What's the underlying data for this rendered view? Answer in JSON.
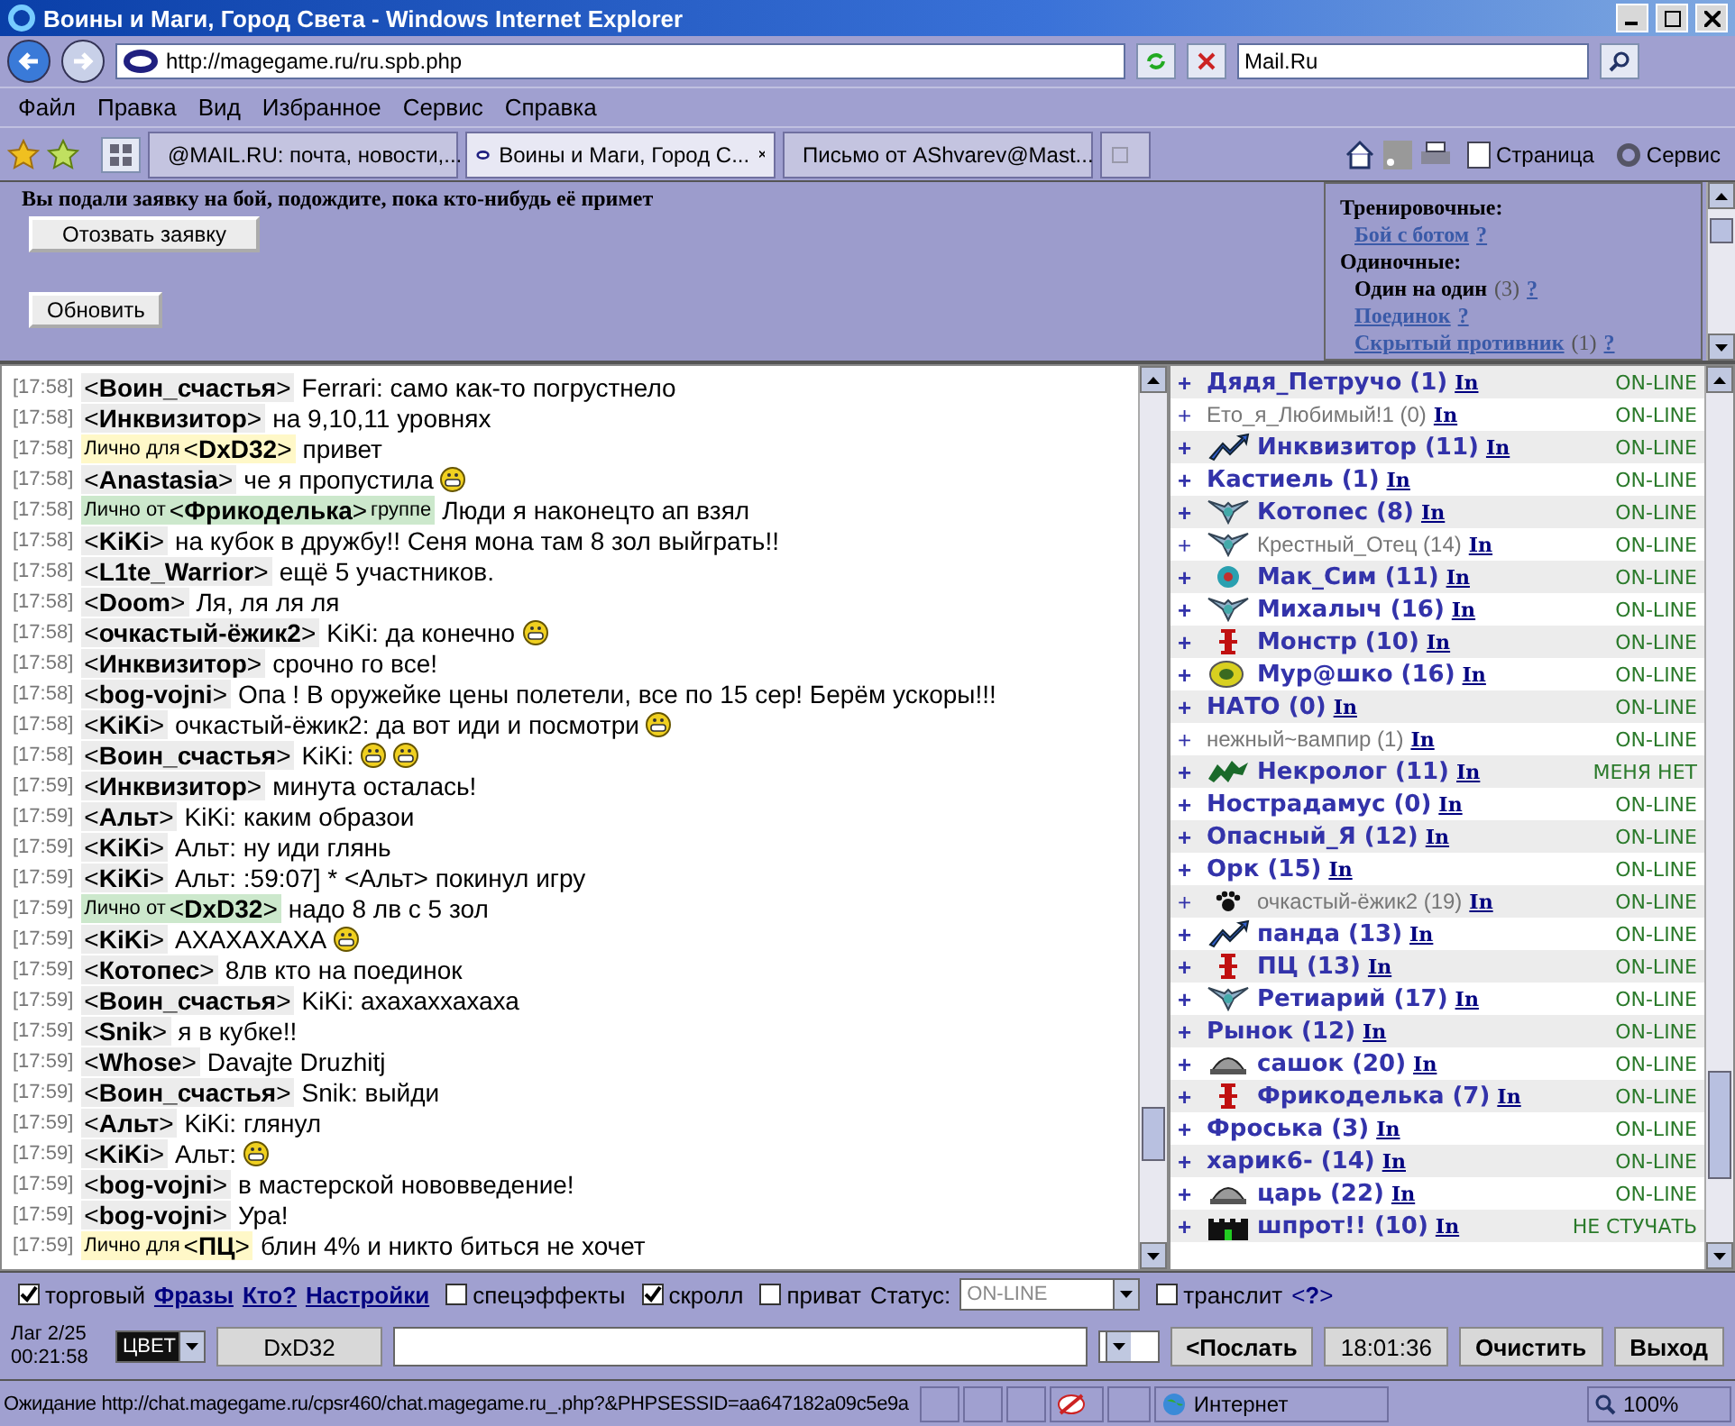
{
  "window": {
    "title": "Воины и Маги, Город Света - Windows Internet Explorer"
  },
  "address_bar": {
    "url": "http://magegame.ru/ru.spb.php",
    "search": "Mail.Ru"
  },
  "menu": [
    "Файл",
    "Правка",
    "Вид",
    "Избранное",
    "Сервис",
    "Справка"
  ],
  "tabs": [
    {
      "label": "@MAIL.RU: почта, новости,...",
      "selected": false,
      "kind": "mail"
    },
    {
      "label": "Воины и Маги, Город С...",
      "selected": true,
      "kind": "php"
    },
    {
      "label": "Письмо от AShvarev@Mast...",
      "selected": false,
      "kind": "letter"
    }
  ],
  "toolbar": {
    "page": "Страница",
    "tools": "Сервис"
  },
  "battle": {
    "message": "Вы подали заявку на бой, подождите, пока кто-нибудь её примет",
    "buttons": [
      "Отозвать заявку",
      "Обновить"
    ],
    "types": [
      {
        "kind": "heading",
        "label": "Тренировочные:"
      },
      {
        "kind": "link",
        "label": "Бой с ботом",
        "help": "?"
      },
      {
        "kind": "heading",
        "label": "Одиночные:"
      },
      {
        "kind": "current",
        "label": "Один на один",
        "count": "(3)",
        "help": "?"
      },
      {
        "kind": "link",
        "label": "Поединок",
        "help": "?"
      },
      {
        "kind": "link",
        "label": "Скрытый противник",
        "count": "(1)",
        "help": "?"
      }
    ]
  },
  "chat": [
    {
      "time": "[17:58]",
      "kind": "public",
      "sender": "<**Воин_счастья**>",
      "text": "Ferrari: само как-то погрустнело"
    },
    {
      "time": "[17:58]",
      "kind": "public",
      "sender": "<**Инквизитор**>",
      "text": "на 9,10,11 уровнях"
    },
    {
      "time": "[17:58]",
      "kind": "to",
      "prefix": "Лично для",
      "sender": "<**DxD32**>",
      "text": "привет"
    },
    {
      "time": "[17:58]",
      "kind": "public",
      "sender": "<**Anastasia**>",
      "text": "че я пропустила",
      "smileys": [
        {
          "kind": "grin"
        }
      ]
    },
    {
      "time": "[17:58]",
      "kind": "from",
      "prefix": "Лично от",
      "sender": "<**Фрикоделька**>",
      "suffix": "группе",
      "text": "Люди я наконецто ап взял"
    },
    {
      "time": "[17:58]",
      "kind": "public",
      "sender": "<**KiKi**>",
      "text": "на кубок в дружбу!! Сеня мона там 8 зол выйграть!!"
    },
    {
      "time": "[17:58]",
      "kind": "public",
      "sender": "<**L1te_Warrior**>",
      "text": "ещё 5 участников."
    },
    {
      "time": "[17:58]",
      "kind": "public",
      "sender": "<**Doom**>",
      "text": "Ля, ля ля ля"
    },
    {
      "time": "[17:58]",
      "kind": "public",
      "sender": "<**очкастый-ёжик2**>",
      "text": "KiKi: да конечно",
      "smileys": [
        {
          "kind": "grin"
        }
      ]
    },
    {
      "time": "[17:58]",
      "kind": "public",
      "sender": "<**Инквизитор**>",
      "text": "срочно го все!"
    },
    {
      "time": "[17:58]",
      "kind": "public",
      "sender": "<**bog-vojni**>",
      "text": "Опа ! В оружейке цены полетели, все по 15 сер! Берём ускоры!!!"
    },
    {
      "time": "[17:58]",
      "kind": "public",
      "sender": "<**KiKi**>",
      "text": "очкастый-ёжик2: да вот иди и посмотри",
      "smileys": [
        {
          "kind": "grin"
        }
      ]
    },
    {
      "time": "[17:58]",
      "kind": "public",
      "sender": "<**Воин_счастья**>",
      "text": "KiKi:",
      "smileys": [
        {
          "kind": "grin"
        },
        {
          "kind": "grin"
        }
      ]
    },
    {
      "time": "[17:59]",
      "kind": "public",
      "sender": "<**Инквизитор**>",
      "text": "минута осталась!"
    },
    {
      "time": "[17:59]",
      "kind": "public",
      "sender": "<**Альт**>",
      "text": "KiKi: каким образои"
    },
    {
      "time": "[17:59]",
      "kind": "public",
      "sender": "<**KiKi**>",
      "text": "Альт: ну иди глянь"
    },
    {
      "time": "[17:59]",
      "kind": "public",
      "sender": "<**KiKi**>",
      "text": "Альт: :59:07] * <Альт> покинул игру"
    },
    {
      "time": "[17:59]",
      "kind": "from",
      "prefix": "Лично от",
      "sender": "<**DxD32**>",
      "text": "надо 8 лв с 5 зол"
    },
    {
      "time": "[17:59]",
      "kind": "public",
      "sender": "<**KiKi**>",
      "text": "АХАХАХАХА",
      "smileys": [
        {
          "kind": "grin"
        }
      ]
    },
    {
      "time": "[17:59]",
      "kind": "public",
      "sender": "<**Котопес**>",
      "text": "8лв кто на поединок"
    },
    {
      "time": "[17:59]",
      "kind": "public",
      "sender": "<**Воин_счастья**>",
      "text": "KiKi: ахахаххахаха"
    },
    {
      "time": "[17:59]",
      "kind": "public",
      "sender": "<**Snik**>",
      "text": "я в кубке!!"
    },
    {
      "time": "[17:59]",
      "kind": "public",
      "sender": "<**Whose**>",
      "text": "Davajte Druzhitj"
    },
    {
      "time": "[17:59]",
      "kind": "public",
      "sender": "<**Воин_счастья**>",
      "text": "Snik: выйди"
    },
    {
      "time": "[17:59]",
      "kind": "public",
      "sender": "<**Альт**>",
      "text": "KiKi: глянул"
    },
    {
      "time": "[17:59]",
      "kind": "public",
      "sender": "<**KiKi**>",
      "text": "Альт:",
      "smileys": [
        {
          "kind": "grin"
        }
      ]
    },
    {
      "time": "[17:59]",
      "kind": "public",
      "sender": "<**bog-vojni**>",
      "text": "в мастерской нововведение!"
    },
    {
      "time": "[17:59]",
      "kind": "public",
      "sender": "<**bog-vojni**>",
      "text": "Ура!"
    },
    {
      "time": "[17:59]",
      "kind": "to",
      "prefix": "Лично для",
      "sender": "<**ПЦ**>",
      "text": "блин 4% и никто биться не хочет"
    }
  ],
  "users": [
    {
      "expander": "+",
      "name": "Дядя_Петручо (1)",
      "link": "In",
      "status": "ON-LINE",
      "bold": true
    },
    {
      "expander": "+",
      "name": "Ето_я_Любимый!1 (0)",
      "link": "In",
      "status": "ON-LINE",
      "bold": false
    },
    {
      "expander": "+",
      "name": "Инквизитор (11)",
      "link": "In",
      "status": "ON-LINE",
      "bold": true,
      "emblem": {
        "kind": "arrow"
      }
    },
    {
      "expander": "+",
      "name": "Кастиель (1)",
      "link": "In",
      "status": "ON-LINE",
      "bold": true
    },
    {
      "expander": "+",
      "name": "Котопес (8)",
      "link": "In",
      "status": "ON-LINE",
      "bold": true,
      "emblem": {
        "kind": "wings"
      }
    },
    {
      "expander": "+",
      "name": "Крестный_Отец (14)",
      "link": "In",
      "status": "ON-LINE",
      "bold": false,
      "emblem": {
        "kind": "wings"
      }
    },
    {
      "expander": "+",
      "name": "Мак_Сим (11)",
      "link": "In",
      "status": "ON-LINE",
      "bold": true,
      "emblem": {
        "kind": "orb"
      }
    },
    {
      "expander": "+",
      "name": "Михалыч (16)",
      "link": "In",
      "status": "ON-LINE",
      "bold": true,
      "emblem": {
        "kind": "wings"
      }
    },
    {
      "expander": "+",
      "name": "Монстр (10)",
      "link": "In",
      "status": "ON-LINE",
      "bold": true,
      "emblem": {
        "kind": "cross"
      }
    },
    {
      "expander": "+",
      "name": "Мур@шко (16)",
      "link": "In",
      "status": "ON-LINE",
      "bold": true,
      "emblem": {
        "kind": "ring"
      }
    },
    {
      "expander": "+",
      "name": "НАТО (0)",
      "link": "In",
      "status": "ON-LINE",
      "bold": true
    },
    {
      "expander": "+",
      "name": "нежный~вампир (1)",
      "link": "In",
      "status": "ON-LINE",
      "bold": false
    },
    {
      "expander": "+",
      "name": "Некролог (11)",
      "link": "In",
      "status": "МЕНЯ НЕТ",
      "bold": true,
      "emblem": {
        "kind": "dragon"
      }
    },
    {
      "expander": "+",
      "name": "Нострадамус (0)",
      "link": "In",
      "status": "ON-LINE",
      "bold": true
    },
    {
      "expander": "+",
      "name": "Опасный_Я (12)",
      "link": "In",
      "status": "ON-LINE",
      "bold": true
    },
    {
      "expander": "+",
      "name": "Орк (15)",
      "link": "In",
      "status": "ON-LINE",
      "bold": true
    },
    {
      "expander": "+",
      "name": "очкастый-ёжик2 (19)",
      "link": "In",
      "status": "ON-LINE",
      "bold": false,
      "emblem": {
        "kind": "paw"
      }
    },
    {
      "expander": "+",
      "name": "панда (13)",
      "link": "In",
      "status": "ON-LINE",
      "bold": true,
      "emblem": {
        "kind": "arrow"
      }
    },
    {
      "expander": "+",
      "name": "ПЦ (13)",
      "link": "In",
      "status": "ON-LINE",
      "bold": true,
      "emblem": {
        "kind": "cross"
      }
    },
    {
      "expander": "+",
      "name": "Ретиарий (17)",
      "link": "In",
      "status": "ON-LINE",
      "bold": true,
      "emblem": {
        "kind": "wings"
      }
    },
    {
      "expander": "+",
      "name": "Рынок (12)",
      "link": "In",
      "status": "ON-LINE",
      "bold": true
    },
    {
      "expander": "+",
      "name": "сашок (20)",
      "link": "In",
      "status": "ON-LINE",
      "bold": true,
      "emblem": {
        "kind": "helmet"
      }
    },
    {
      "expander": "+",
      "name": "Фрикоделька (7)",
      "link": "In",
      "status": "ON-LINE",
      "bold": true,
      "emblem": {
        "kind": "cross"
      }
    },
    {
      "expander": "+",
      "name": "Фроська (3)",
      "link": "In",
      "status": "ON-LINE",
      "bold": true
    },
    {
      "expander": "+",
      "name": "харик6- (14)",
      "link": "In",
      "status": "ON-LINE",
      "bold": true
    },
    {
      "expander": "+",
      "name": "царь (22)",
      "link": "In",
      "status": "ON-LINE",
      "bold": true,
      "emblem": {
        "kind": "helmet"
      }
    },
    {
      "expander": "+",
      "name": "шпрот!! (10)",
      "link": "In",
      "status": "НЕ СТУЧАТЬ",
      "bold": true,
      "emblem": {
        "kind": "castle"
      }
    }
  ],
  "options": [
    {
      "kind": "checkbox",
      "label": "торговый",
      "checked": true
    },
    {
      "kind": "link",
      "label": "Фразы"
    },
    {
      "kind": "link",
      "label": "Кто?"
    },
    {
      "kind": "link",
      "label": "Настройки"
    },
    {
      "kind": "checkbox",
      "label": "спецэффекты",
      "checked": false
    },
    {
      "kind": "checkbox",
      "label": "скролл",
      "checked": true
    },
    {
      "kind": "checkbox",
      "label": "приват",
      "checked": false
    },
    {
      "kind": "select",
      "label": "Статус:",
      "value": "ON-LINE"
    },
    {
      "kind": "checkbox",
      "label": "транслит",
      "checked": false
    },
    {
      "kind": "help",
      "label": "<**?**>"
    }
  ],
  "input_bar": {
    "lag": "Лаг 2/25",
    "clock": "00:21:58",
    "color_picker": "ЦВЕТ",
    "recipient": "DxD32",
    "send": "<Послать",
    "time": "18:01:36",
    "clear": "Очистить",
    "exit": "Выход"
  },
  "status_bar": {
    "text": "Ожидание http://chat.magegame.ru/cpsr460/chat.magegame.ru_.php?&PHPSESSID=aa647182a09c5e9a",
    "zone": "Интернет",
    "zoom": "100%"
  }
}
